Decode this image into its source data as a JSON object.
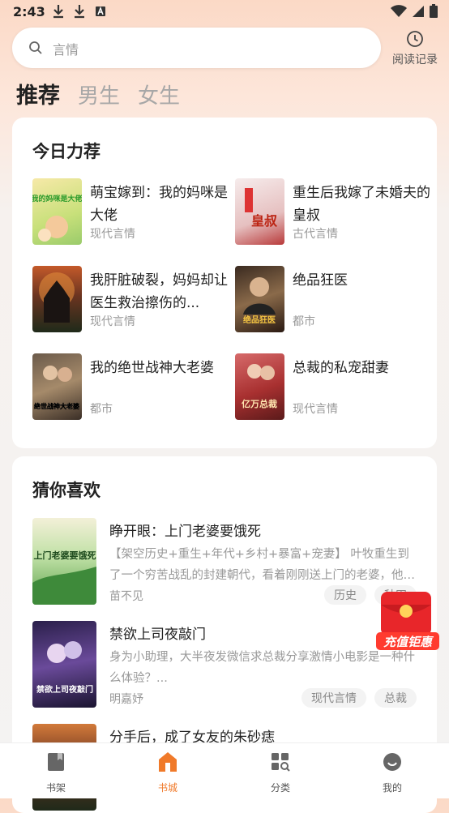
{
  "status": {
    "time": "2:43"
  },
  "search": {
    "placeholder": "言情"
  },
  "history": {
    "label": "阅读记录"
  },
  "tabs": [
    {
      "label": "推荐",
      "active": true
    },
    {
      "label": "男生",
      "active": false
    },
    {
      "label": "女生",
      "active": false
    }
  ],
  "today": {
    "title": "今日力荐",
    "items": [
      {
        "title": "萌宝嫁到：我的妈咪是大佬",
        "genre": "现代言情",
        "cover_text": "我的妈咪是大佬"
      },
      {
        "title": "重生后我嫁了未婚夫的皇叔",
        "genre": "古代言情",
        "cover_text": "皇叔"
      },
      {
        "title": "我肝脏破裂，妈妈却让医生救治擦伤的...",
        "genre": "现代言情",
        "cover_text": ""
      },
      {
        "title": "绝品狂医",
        "genre": "都市",
        "cover_text": "绝品狂医"
      },
      {
        "title": "我的绝世战神大老婆",
        "genre": "都市",
        "cover_text": "绝世战神大老婆"
      },
      {
        "title": "总裁的私宠甜妻",
        "genre": "现代言情",
        "cover_text": "亿万总裁"
      }
    ]
  },
  "guess": {
    "title": "猜你喜欢",
    "items": [
      {
        "title": "睁开眼：上门老婆要饿死",
        "desc": "【架空历史+重生+年代+乡村+暴富+宠妻】 叶牧重生到了一个穷苦战乱的封建朝代，看着刚刚送上门的老婆，他决...",
        "author": "苗不见",
        "tags": [
          "历史",
          "种田"
        ],
        "cover_text": "上门老婆要饿死"
      },
      {
        "title": "禁欲上司夜敲门",
        "desc": "身为小助理，大半夜发微信求总裁分享激情小电影是一种什么体验？...",
        "author": "明嘉妤",
        "tags": [
          "现代言情",
          "总裁"
        ],
        "cover_text": "禁欲上司夜敲门"
      },
      {
        "title": "分手后，成了女友的朱砂痣",
        "desc": "",
        "author": "",
        "tags": [],
        "cover_text": ""
      }
    ]
  },
  "promo": {
    "label": "充值钜惠"
  },
  "nav": [
    {
      "label": "书架",
      "icon": "bookshelf-icon",
      "active": false
    },
    {
      "label": "书城",
      "icon": "bookstore-icon",
      "active": true
    },
    {
      "label": "分类",
      "icon": "category-icon",
      "active": false
    },
    {
      "label": "我的",
      "icon": "profile-icon",
      "active": false
    }
  ],
  "colors": {
    "accent": "#f07a2a",
    "promo_red": "#e8262a"
  }
}
